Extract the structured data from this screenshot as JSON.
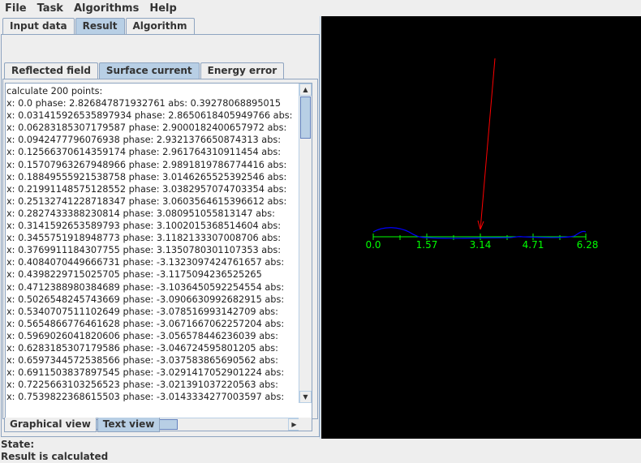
{
  "menubar": {
    "items": [
      "File",
      "Task",
      "Algorithms",
      "Help"
    ]
  },
  "top_tabs": [
    {
      "label": "Input data",
      "selected": false
    },
    {
      "label": "Result",
      "selected": true
    },
    {
      "label": "Algorithm",
      "selected": false
    }
  ],
  "inner_tabs": [
    {
      "label": "Reflected field",
      "selected": false
    },
    {
      "label": "Surface current",
      "selected": true
    },
    {
      "label": "Energy error",
      "selected": false
    }
  ],
  "text_view": {
    "lines": [
      "calculate 200 points:",
      "x: 0.0 phase: 2.826847871932761 abs: 0.39278068895015",
      "x: 0.031415926535897934 phase: 2.8650618405949766 abs:",
      "x: 0.06283185307179587 phase: 2.9000182400657972 abs:",
      "x: 0.0942477796076938 phase: 2.9321376650874313 abs:",
      "x: 0.12566370614359174 phase: 2.961764310911454 abs:",
      "x: 0.15707963267948966 phase: 2.9891819786774416 abs:",
      "x: 0.18849555921538758 phase: 3.0146265525392546 abs:",
      "x: 0.21991148575128552 phase: 3.0382957074703354 abs:",
      "x: 0.25132741228718347 phase: 3.0603564615396612 abs:",
      "x: 0.2827433388230814 phase: 3.080951055813147 abs:",
      "x: 0.3141592653589793 phase: 3.1002015368514604 abs:",
      "x: 0.3455751918948773 phase: 3.1182133307008706 abs:",
      "x: 0.3769911184307755 phase: 3.1350780301107353 abs:",
      "x: 0.4084070449666731 phase: -3.1323097424761657 abs:",
      "x: 0.4398229715025705 phase: -3.1175094236525265",
      "x: 0.4712388980384689 phase: -3.1036450592254554 abs:",
      "x: 0.5026548245743669 phase: -3.0906630992682915 abs:",
      "x: 0.5340707511102649 phase: -3.078516993142709 abs:",
      "x: 0.5654866776461628 phase: -3.0671667062257204 abs:",
      "x: 0.5969026041820606 phase: -3.056578446236039 abs:",
      "x: 0.6283185307179586 phase: -3.046724595801205 abs:",
      "x: 0.6597344572538566 phase: -3.037583865690562 abs:",
      "x: 0.6911503837897545 phase: -3.0291417052901224 abs:",
      "x: 0.7225663103256523 phase: -3.021391037220563 abs:",
      "x: 0.7539822368615503 phase: -3.0143334277003597 abs:"
    ]
  },
  "bottom_tabs": [
    {
      "label": "Graphical view",
      "selected": false
    },
    {
      "label": "Text view",
      "selected": true
    }
  ],
  "canvas": {
    "tick_labels": [
      "0.0",
      "1.57",
      "3.14",
      "4.71",
      "6.28"
    ],
    "colors": {
      "background": "#000000",
      "axis": "#00ff00",
      "curve": "#0000ff",
      "arrow": "#ff0000"
    }
  },
  "status": {
    "label": "State:",
    "message": "Result is calculated"
  }
}
